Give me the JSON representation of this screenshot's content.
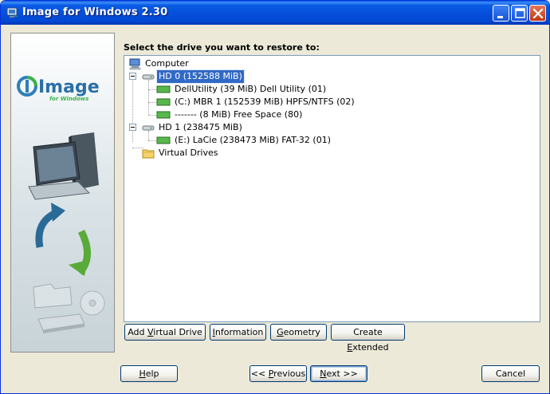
{
  "window": {
    "title": "Image for Windows 2.30"
  },
  "logo": {
    "brand": "Image",
    "tagline": "for Windows"
  },
  "prompt": "Select the drive you want to restore to:",
  "tree": {
    "nodes": [
      {
        "label": "Computer",
        "icon": "computer-icon"
      },
      {
        "label": "HD 0 (152588 MiB)",
        "icon": "hard-drive-icon",
        "selected": true
      },
      {
        "label": "DellUtility (39 MiB) Dell Utility (01)",
        "icon": "partition-icon"
      },
      {
        "label": "(C:) MBR 1 (152539 MiB) HPFS/NTFS (02)",
        "icon": "partition-icon"
      },
      {
        "label": "------- (8 MiB) Free Space (80)",
        "icon": "partition-icon"
      },
      {
        "label": "HD 1 (238475 MiB)",
        "icon": "hard-drive-icon"
      },
      {
        "label": "(E:) LaCie (238473 MiB) FAT-32 (01)",
        "icon": "partition-icon"
      },
      {
        "label": "Virtual Drives",
        "icon": "folder-icon"
      }
    ]
  },
  "actions": {
    "add_virtual_drive": {
      "pre": "Add ",
      "ul": "V",
      "post": "irtual Drive"
    },
    "information": {
      "pre": "",
      "ul": "I",
      "post": "nformation"
    },
    "geometry": {
      "pre": "",
      "ul": "G",
      "post": "eometry"
    },
    "create_extended": {
      "pre": "Create ",
      "ul": "E",
      "post": "xtended"
    }
  },
  "nav": {
    "help": {
      "pre": "",
      "ul": "H",
      "post": "elp"
    },
    "previous": {
      "pre": "<< ",
      "ul": "P",
      "post": "revious"
    },
    "next": {
      "pre": "",
      "ul": "N",
      "post": "ext >>"
    },
    "cancel": "Cancel"
  },
  "colors": {
    "titlebar": "#0550dc",
    "selection": "#316ac5",
    "dialog_bg": "#ece9d8"
  }
}
